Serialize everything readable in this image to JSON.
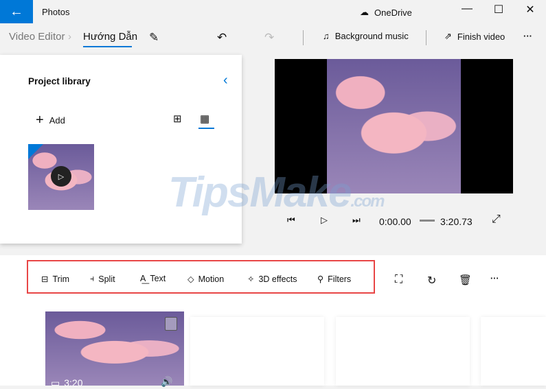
{
  "app": {
    "title": "Photos",
    "cloud": "OneDrive"
  },
  "breadcrumb": {
    "root": "Video Editor",
    "current": "Hướng Dẫn"
  },
  "toolbar": {
    "background_music": "Background music",
    "finish_video": "Finish video"
  },
  "library": {
    "title": "Project library",
    "add": "Add"
  },
  "player": {
    "current_time": "0:00.00",
    "total_time": "3:20.73"
  },
  "edit_tools": [
    {
      "label": "Trim",
      "icon": "trim-icon"
    },
    {
      "label": "Split",
      "icon": "split-icon"
    },
    {
      "label": "Text",
      "icon": "text-icon"
    },
    {
      "label": "Motion",
      "icon": "motion-icon"
    },
    {
      "label": "3D effects",
      "icon": "3d-effects-icon"
    },
    {
      "label": "Filters",
      "icon": "filters-icon"
    }
  ],
  "timeline": {
    "clip_duration": "3:20"
  },
  "watermark": "TipsMake.com",
  "colors": {
    "accent": "#0078d7",
    "highlight": "#e84545"
  }
}
